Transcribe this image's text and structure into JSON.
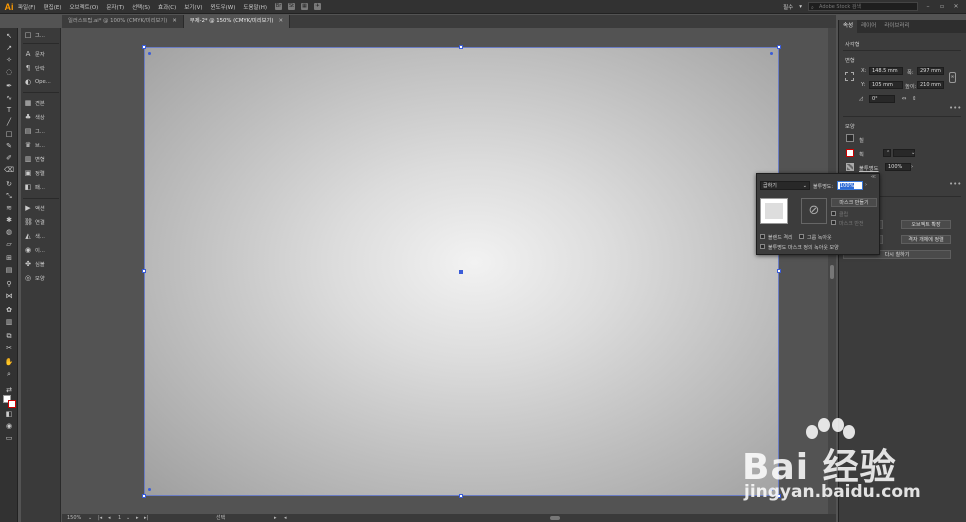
{
  "app": {
    "logo": "Ai"
  },
  "menu": [
    "파일(F)",
    "편집(E)",
    "오브젝트(O)",
    "문자(T)",
    "선택(S)",
    "효과(C)",
    "보기(V)",
    "윈도우(W)",
    "도움말(H)"
  ],
  "menu_toolbar": {
    "br": "Br",
    "st": "St"
  },
  "workspace": "필수",
  "search": {
    "placeholder": "Adobe Stock 검색"
  },
  "tabs": [
    {
      "label": "일러스트팁.ai* @ 100% (CMYK/미리보기)",
      "active": false
    },
    {
      "label": "무제-2* @ 150% (CMYK/미리보기)",
      "active": true
    }
  ],
  "side_panels": [
    {
      "icon": "□",
      "label": "그..."
    },
    {
      "icon": "A",
      "label": "문자"
    },
    {
      "icon": "¶",
      "label": "단락"
    },
    {
      "icon": "◐",
      "label": "Ope..."
    },
    {
      "icon": "▦",
      "label": "견본"
    },
    {
      "icon": "♣",
      "label": "색상"
    },
    {
      "icon": "▤",
      "label": "그..."
    },
    {
      "icon": "♛",
      "label": "브..."
    },
    {
      "icon": "▥",
      "label": "변형"
    },
    {
      "icon": "▣",
      "label": "정렬"
    },
    {
      "icon": "◧",
      "label": "패..."
    },
    {
      "icon": "▶",
      "label": "액션"
    },
    {
      "icon": "⛓",
      "label": "연결"
    },
    {
      "icon": "◭",
      "label": "색..."
    },
    {
      "icon": "◉",
      "label": "이..."
    },
    {
      "icon": "✤",
      "label": "심볼"
    },
    {
      "icon": "◎",
      "label": "모양"
    }
  ],
  "right_panel": {
    "tabs": [
      "속성",
      "레이어",
      "라이브러리"
    ],
    "section_title": "사각형",
    "transform": {
      "label": "변형",
      "x_label": "X:",
      "x": "148.5 mm",
      "y_label": "Y:",
      "y": "105 mm",
      "w_label": "폭:",
      "w": "297 mm",
      "h_label": "높이:",
      "h": "210 mm",
      "angle": "0°"
    },
    "appearance": {
      "label": "모양",
      "fill_label": "칠",
      "stroke_label": "획",
      "opacity_label": "불투명도",
      "opacity": "100%",
      "fx": "fx"
    },
    "buttons": {
      "b1": "오브젝트 확장",
      "b1_left": "...",
      "b2": "격자 개체에 정렬",
      "b2_left": "...",
      "b3": "다시 칠하기"
    }
  },
  "transparency_popup": {
    "blend_mode": "곱하기",
    "opacity_label": "불투명도:",
    "opacity": "100%",
    "make_mask": "마스크 만들기",
    "clip": "클립",
    "invert_mask": "마스크 반전",
    "isolate_blending": "블렌드 격리",
    "knockout_group": "그룹 녹아웃",
    "opacity_mask_knockout": "불투명도 마스크 정의 녹아웃 모양"
  },
  "status": {
    "zoom": "150%",
    "page": "1",
    "mode": "선택"
  },
  "watermark": {
    "main": "Bai  经验",
    "url": "jingyan.baidu.com"
  }
}
